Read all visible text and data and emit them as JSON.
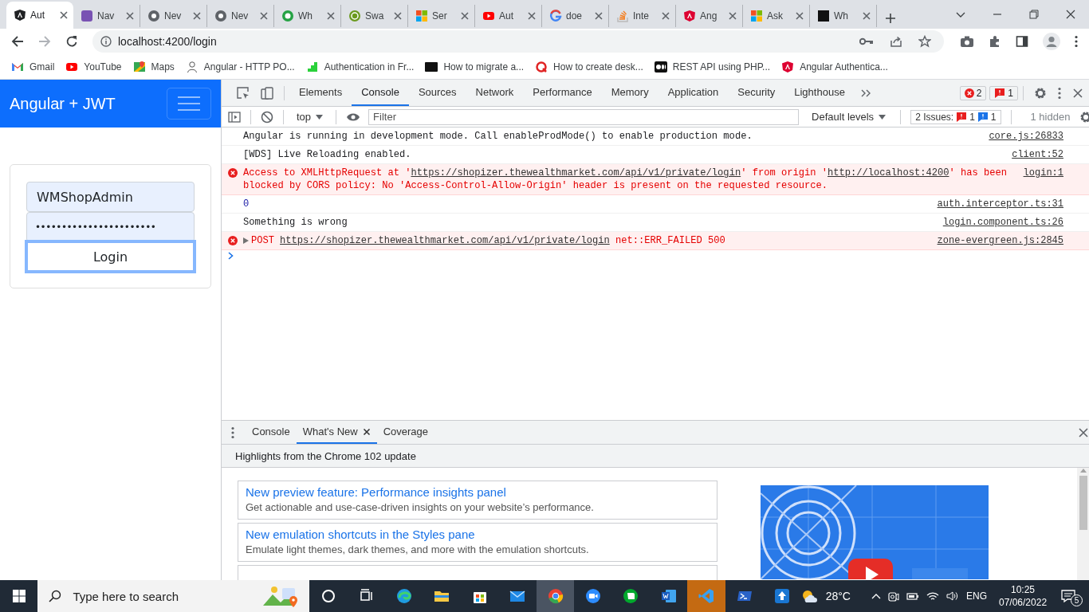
{
  "browser": {
    "tabs": [
      {
        "title": "Aut",
        "selected": true
      },
      {
        "title": "Nav",
        "selected": false
      },
      {
        "title": "Nev",
        "selected": false
      },
      {
        "title": "Nev",
        "selected": false
      },
      {
        "title": "Wh",
        "selected": false
      },
      {
        "title": "Swa",
        "selected": false
      },
      {
        "title": "Ser",
        "selected": false
      },
      {
        "title": "Aut",
        "selected": false
      },
      {
        "title": "doe",
        "selected": false
      },
      {
        "title": "Inte",
        "selected": false
      },
      {
        "title": "Ang",
        "selected": false
      },
      {
        "title": "Ask",
        "selected": false
      },
      {
        "title": "Wh",
        "selected": false
      }
    ],
    "address": "localhost:4200/login",
    "bookmarks": [
      "Gmail",
      "YouTube",
      "Maps",
      "Angular - HTTP PO...",
      "Authentication in Fr...",
      "How to migrate a...",
      "How to create desk...",
      "REST API using PHP...",
      "Angular Authentica..."
    ]
  },
  "page": {
    "brand": "Angular + JWT",
    "username": "WMShopAdmin",
    "password": "•••••••••••••••••••••••",
    "login_button": "Login"
  },
  "devtools": {
    "tabs": [
      {
        "label": "Elements",
        "selected": false
      },
      {
        "label": "Console",
        "selected": true
      },
      {
        "label": "Sources",
        "selected": false
      },
      {
        "label": "Network",
        "selected": false
      },
      {
        "label": "Performance",
        "selected": false
      },
      {
        "label": "Memory",
        "selected": false
      },
      {
        "label": "Application",
        "selected": false
      },
      {
        "label": "Security",
        "selected": false
      },
      {
        "label": "Lighthouse",
        "selected": false
      }
    ],
    "errors_count": "2",
    "issues_count": "1",
    "console_toolbar": {
      "context": "top",
      "filter_placeholder": "Filter",
      "levels": "Default levels",
      "issues_label": "2 Issues:",
      "issues_errors": "1",
      "issues_info": "1",
      "hidden": "1 hidden"
    },
    "messages": [
      {
        "kind": "log",
        "expandable": false,
        "parts": [
          {
            "kind": "text",
            "text": "Angular is running in development mode. Call enableProdMode() to enable production mode."
          }
        ],
        "source": "core.js:26833"
      },
      {
        "kind": "log",
        "expandable": false,
        "parts": [
          {
            "kind": "text",
            "text": "[WDS] Live Reloading enabled."
          }
        ],
        "source": "client:52"
      },
      {
        "kind": "error",
        "expandable": false,
        "parts": [
          {
            "kind": "text",
            "text": "Access to XMLHttpRequest at '"
          },
          {
            "kind": "link",
            "text": "https://shopizer.thewealthmarket.com/api/v1/private/login"
          },
          {
            "kind": "text",
            "text": "' from origin '"
          },
          {
            "kind": "link",
            "text": "http://localhost:4200"
          },
          {
            "kind": "text",
            "text": "' has been blocked by CORS policy: No 'Access-Control-Allow-Origin' header is present on the requested resource."
          }
        ],
        "source": "login:1"
      },
      {
        "kind": "number",
        "expandable": false,
        "parts": [
          {
            "kind": "text",
            "text": "0"
          }
        ],
        "source": "auth.interceptor.ts:31"
      },
      {
        "kind": "log",
        "expandable": false,
        "parts": [
          {
            "kind": "text",
            "text": "Something is wrong"
          }
        ],
        "source": "login.component.ts:26"
      },
      {
        "kind": "error",
        "expandable": true,
        "parts": [
          {
            "kind": "method",
            "text": "POST"
          },
          {
            "kind": "link",
            "text": "https://shopizer.thewealthmarket.com/api/v1/private/login"
          },
          {
            "kind": "text",
            "text": " net::ERR_FAILED 500"
          }
        ],
        "source": "zone-evergreen.js:2845"
      }
    ],
    "drawer": {
      "tabs": [
        {
          "label": "Console",
          "selected": false,
          "closable": false
        },
        {
          "label": "What's New",
          "selected": true,
          "closable": true
        },
        {
          "label": "Coverage",
          "selected": false,
          "closable": false
        }
      ],
      "header": "Highlights from the Chrome 102 update",
      "cards": [
        {
          "title": "New preview feature: Performance insights panel",
          "description": "Get actionable and use-case-driven insights on your website’s performance."
        },
        {
          "title": "New emulation shortcuts in the Styles pane",
          "description": "Emulate light themes, dark themes, and more with the emulation shortcuts."
        }
      ]
    }
  },
  "taskbar": {
    "search_placeholder": "Type here to search",
    "apps": [
      {
        "active": false,
        "attention": false
      },
      {
        "active": false,
        "attention": false
      },
      {
        "active": false,
        "attention": false
      },
      {
        "active": false,
        "attention": false
      },
      {
        "active": false,
        "attention": false
      },
      {
        "active": true,
        "attention": false
      },
      {
        "active": false,
        "attention": false
      },
      {
        "active": false,
        "attention": false
      },
      {
        "active": false,
        "attention": false
      },
      {
        "active": false,
        "attention": true
      },
      {
        "active": false,
        "attention": false
      },
      {
        "active": false,
        "attention": false
      }
    ],
    "weather": "28°C",
    "language": "ENG",
    "time": "10:25",
    "date": "07/06/2022",
    "notifications": "5"
  }
}
